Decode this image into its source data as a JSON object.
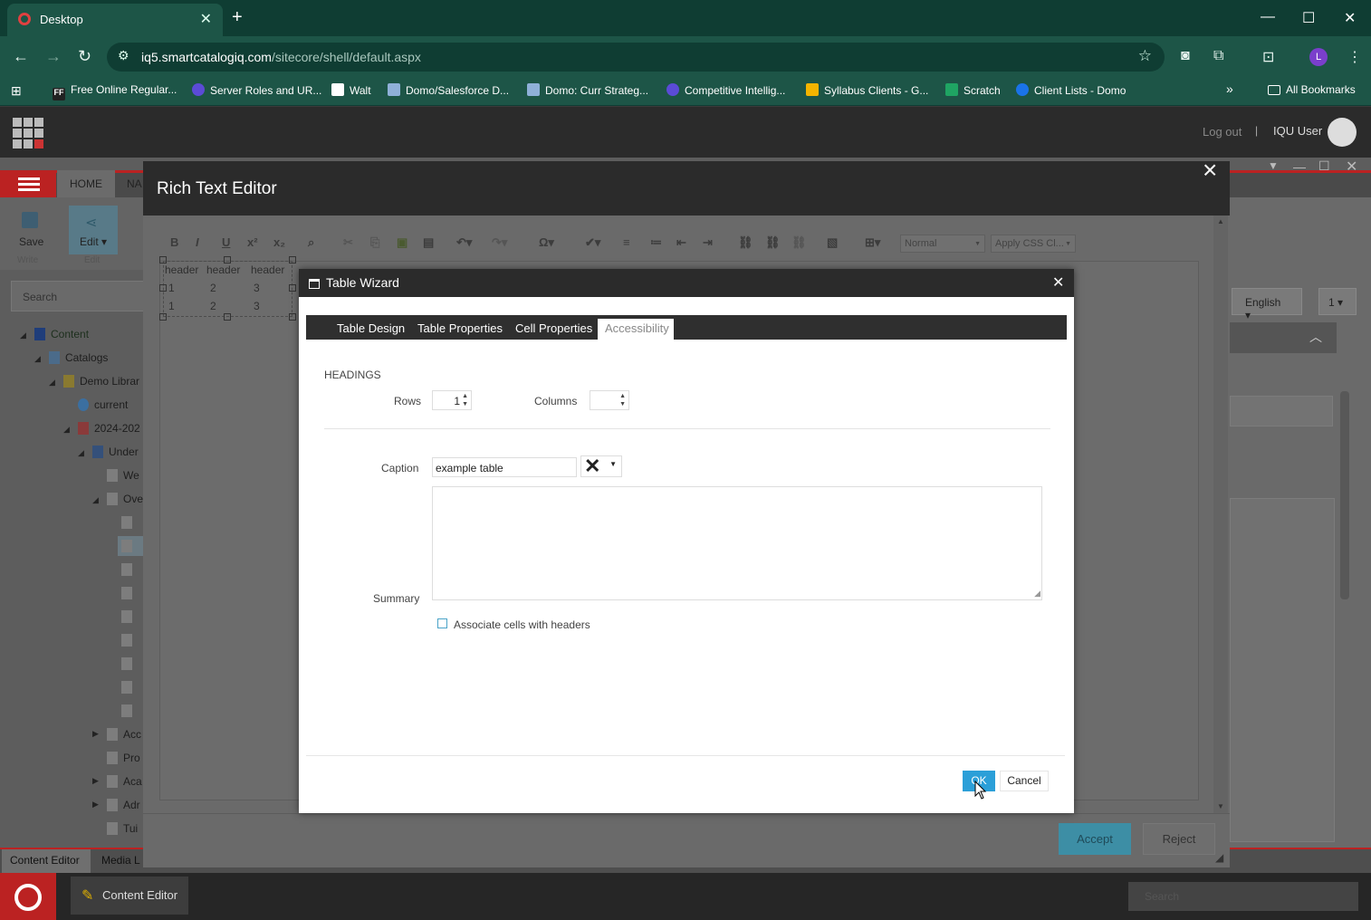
{
  "browser": {
    "tab_title": "Desktop",
    "url_host": "iq5.smartcatalogiq.com",
    "url_path": "/sitecore/shell/default.aspx",
    "profile_initial": "L",
    "bookmarks": [
      {
        "label": "Free Online Regular...",
        "color": "#222222"
      },
      {
        "label": "Server Roles and UR...",
        "color": "#5b4bd6"
      },
      {
        "label": "Walt",
        "color": "#1d2a6b"
      },
      {
        "label": "Domo/Salesforce D...",
        "color": "#8fb0d8"
      },
      {
        "label": "Domo: Curr Strateg...",
        "color": "#8fb0d8"
      },
      {
        "label": "Competitive Intellig...",
        "color": "#5b4bd6"
      },
      {
        "label": "Syllabus Clients - G...",
        "color": "#f4b400"
      },
      {
        "label": "Scratch",
        "color": "#1fa463"
      },
      {
        "label": "Client Lists - Domo",
        "color": "#1a73e8"
      }
    ],
    "bookmarks_overflow": "»",
    "all_bookmarks": "All Bookmarks"
  },
  "sitecore": {
    "logout": "Log out",
    "separator": "|",
    "user": "IQU User",
    "ribbon": {
      "home_tab": "HOME",
      "nav_tab": "NA",
      "save": "Save",
      "write": "Write",
      "edit": "Edit ▾",
      "edit_group": "Edit"
    },
    "search_placeholder": "Search",
    "tree": [
      {
        "label": "Content"
      },
      {
        "label": "Catalogs"
      },
      {
        "label": "Demo Librar"
      },
      {
        "label": "current"
      },
      {
        "label": "2024-202"
      },
      {
        "label": "Under"
      },
      {
        "label": "We"
      },
      {
        "label": "Ove"
      },
      {
        "label": "Acc"
      },
      {
        "label": "Pro"
      },
      {
        "label": "Aca"
      },
      {
        "label": "Adr"
      },
      {
        "label": "Tui"
      }
    ],
    "right_panel": {
      "language": "English ▾",
      "version": "1 ▾"
    },
    "bottom_tabs": [
      "Content Editor",
      "Media L"
    ],
    "taskbar_app": "Content Editor",
    "taskbar_search": "Search"
  },
  "rte": {
    "title": "Rich Text Editor",
    "format_select": "Normal",
    "css_select": "Apply CSS Cl...",
    "table_cells": {
      "header": [
        "header",
        "header",
        "header"
      ],
      "row1": [
        "1",
        "2",
        "3"
      ],
      "row2": [
        "1",
        "2",
        "3"
      ]
    },
    "accept": "Accept",
    "reject": "Reject"
  },
  "wizard": {
    "title": "Table Wizard",
    "tabs": [
      "Table Design",
      "Table Properties",
      "Cell Properties",
      "Accessibility"
    ],
    "active_tab": "Accessibility",
    "headings_label": "HEADINGS",
    "rows_label": "Rows",
    "rows_value": "1",
    "columns_label": "Columns",
    "columns_value": "",
    "caption_label": "Caption",
    "caption_value": "example table",
    "summary_label": "Summary",
    "summary_value": "",
    "associate_label": "Associate cells with headers",
    "associate_checked": false,
    "ok": "OK",
    "cancel": "Cancel"
  }
}
